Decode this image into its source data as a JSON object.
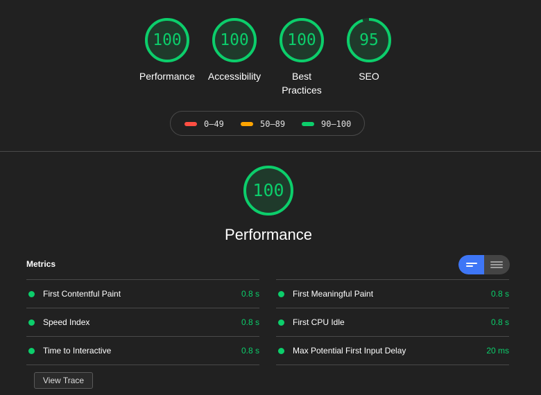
{
  "colors": {
    "pass": "#0cce6b",
    "average": "#ffa400",
    "fail": "#ff4e42",
    "track": "#1f3a2b",
    "accent": "#3e76f6"
  },
  "gauges": [
    {
      "score": "100",
      "label": "Performance",
      "value": 1.0
    },
    {
      "score": "100",
      "label": "Accessibility",
      "value": 1.0
    },
    {
      "score": "100",
      "label": "Best Practices",
      "value": 1.0
    },
    {
      "score": "95",
      "label": "SEO",
      "value": 0.95
    }
  ],
  "legend": [
    {
      "range": "0–49",
      "color": "#ff4e42"
    },
    {
      "range": "50–89",
      "color": "#ffa400"
    },
    {
      "range": "90–100",
      "color": "#0cce6b"
    }
  ],
  "category": {
    "score": "100",
    "title": "Performance",
    "value": 1.0
  },
  "metrics": {
    "title": "Metrics",
    "toggle_icons": [
      "list-view-icon",
      "table-view-icon"
    ],
    "left": [
      {
        "name": "First Contentful Paint",
        "value": "0.8 s"
      },
      {
        "name": "Speed Index",
        "value": "0.8 s"
      },
      {
        "name": "Time to Interactive",
        "value": "0.8 s"
      }
    ],
    "right": [
      {
        "name": "First Meaningful Paint",
        "value": "0.8 s"
      },
      {
        "name": "First CPU Idle",
        "value": "0.8 s"
      },
      {
        "name": "Max Potential First Input Delay",
        "value": "20 ms"
      }
    ]
  },
  "view_trace_label": "View Trace"
}
